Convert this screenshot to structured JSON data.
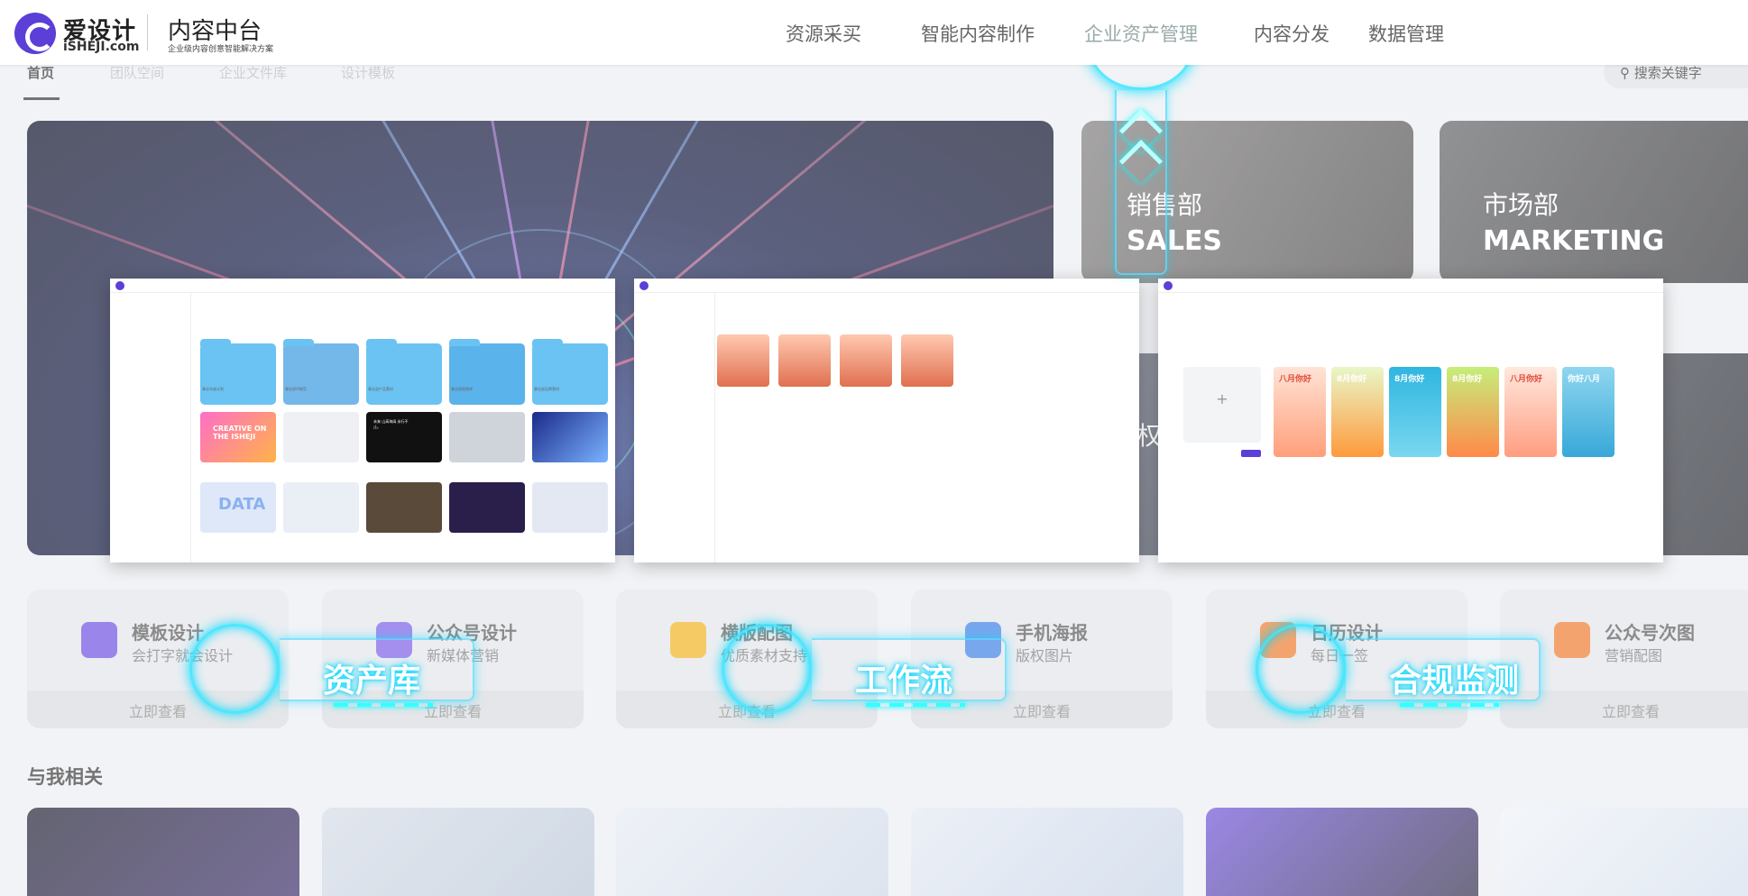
{
  "header": {
    "logo_cn": "爱设计",
    "logo_en": "iSHEJI.com",
    "title": "内容中台",
    "subtitle": "企业级内容创意智能解决方案",
    "nav": [
      "资源采买",
      "智能内容制作",
      "企业资产管理",
      "内容分发",
      "数据管理"
    ],
    "active_nav": "企业资产管理"
  },
  "subtabs": [
    "首页",
    "团队空间",
    "企业文件库",
    "设计模板"
  ],
  "search_placeholder": "搜索关键字",
  "departments": [
    {
      "cn": "销售部",
      "en": "SALES"
    },
    {
      "cn": "市场部",
      "en": "MARKETING"
    }
  ],
  "dept_partial": "权",
  "quick_cards": [
    {
      "title": "模板设计",
      "subtitle": "会打字就会设计",
      "action": "立即查看"
    },
    {
      "title": "公众号设计",
      "subtitle": "新媒体营销",
      "action": "立即查看"
    },
    {
      "title": "横版配图",
      "subtitle": "优质素材支持",
      "action": "立即查看"
    },
    {
      "title": "手机海报",
      "subtitle": "版权图片",
      "action": "立即查看"
    },
    {
      "title": "日历设计",
      "subtitle": "每日一签",
      "action": "立即查看"
    },
    {
      "title": "公众号次图",
      "subtitle": "营销配图",
      "action": "立即查看"
    }
  ],
  "related_title": "与我相关",
  "feature_labels": [
    "资产库",
    "工作流",
    "合规监测"
  ],
  "panel1": {
    "folders": [
      "事业年度计划",
      "事业部VI规范",
      "事业部产品素材",
      "事业部视频库",
      "事业部品牌素材"
    ],
    "items": [
      "CREATIVE ON THE ISHEJI",
      "未来 山高海阔 永行不止。",
      "DATA"
    ]
  },
  "panel3": {
    "posters": [
      "八月你好",
      "8月你好",
      "8月你好",
      "8月你好",
      "八月你好",
      "你好八月"
    ]
  },
  "colors": {
    "brand": "#5b3fd6",
    "glow": "#00e5ff"
  }
}
